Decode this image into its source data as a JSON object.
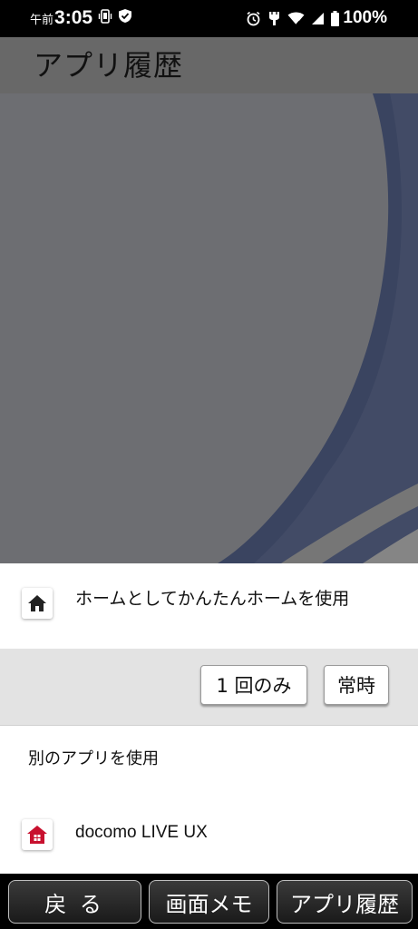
{
  "status_bar": {
    "am_pm": "午前",
    "time": "3:05",
    "battery": "100%"
  },
  "background_app": {
    "title": "アプリ履歴"
  },
  "chooser": {
    "primary_app_label": "ホームとしてかんたんホームを使用",
    "primary_app_icon": "home-icon",
    "just_once_label": "1 回のみ",
    "always_label": "常時",
    "other_section_label": "別のアプリを使用",
    "other_app_label": "docomo LIVE UX",
    "other_app_icon": "red-house-icon",
    "accent_color": "#c8102e"
  },
  "bottom_nav": {
    "back_label": "戻 る",
    "memo_label": "画面メモ",
    "history_label": "アプリ履歴"
  }
}
